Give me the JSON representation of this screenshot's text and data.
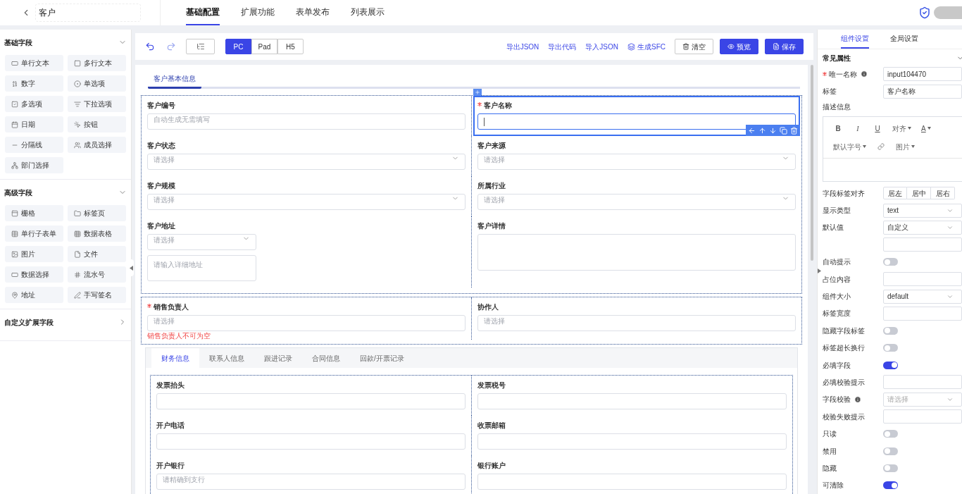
{
  "header": {
    "title": "客户",
    "tabs": [
      {
        "label": "基础配置",
        "selected": true
      },
      {
        "label": "扩展功能",
        "selected": false
      },
      {
        "label": "表单发布",
        "selected": false
      },
      {
        "label": "列表展示",
        "selected": false
      }
    ]
  },
  "palette": [
    {
      "title": "基础字段",
      "expanded": true,
      "items": [
        "单行文本",
        "多行文本",
        "数字",
        "单选项",
        "多选项",
        "下拉选项",
        "日期",
        "按钮",
        "分隔线",
        "成员选择",
        "部门选择"
      ]
    },
    {
      "title": "高级字段",
      "expanded": true,
      "items": [
        "栅格",
        "标签页",
        "单行子表单",
        "数据表格",
        "图片",
        "文件",
        "数据选择",
        "流水号",
        "地址",
        "手写签名"
      ]
    },
    {
      "title": "自定义扩展字段",
      "expanded": false
    }
  ],
  "toolbar": {
    "devices": [
      {
        "label": "PC",
        "selected": true
      },
      {
        "label": "Pad",
        "selected": false
      },
      {
        "label": "H5",
        "selected": false
      }
    ],
    "links": [
      "导出JSON",
      "导出代码",
      "导入JSON",
      "生成SFC"
    ],
    "buttons": [
      {
        "label": "清空",
        "kind": "outline"
      },
      {
        "label": "预览",
        "kind": "primary"
      },
      {
        "label": "保存",
        "kind": "primary"
      }
    ]
  },
  "form": {
    "section_title": "客户基本信息",
    "grid_1": [
      {
        "kind": "input",
        "label": "客户编号",
        "placeholder": "自动生成无需填写",
        "required": false,
        "selected": false
      },
      {
        "kind": "input",
        "label": "客户名称",
        "required": true,
        "selected": true
      },
      {
        "kind": "select",
        "label": "客户状态",
        "placeholder": "请选择",
        "required": false,
        "selected": false
      },
      {
        "kind": "select",
        "label": "客户来源",
        "placeholder": "请选择",
        "required": false,
        "selected": false
      },
      {
        "kind": "select",
        "label": "客户规模",
        "placeholder": "请选择",
        "required": false,
        "selected": false
      },
      {
        "kind": "select",
        "label": "所属行业",
        "placeholder": "请选择",
        "required": false,
        "selected": false
      },
      {
        "kind": "address",
        "label": "客户地址",
        "placeholder": "请选择",
        "detail_placeholder": "请输入详细地址",
        "required": false,
        "selected": false
      },
      {
        "kind": "textarea",
        "label": "客户详情",
        "required": false,
        "selected": false
      }
    ],
    "grid_2": [
      {
        "kind": "input",
        "label": "销售负责人",
        "placeholder": "请选择",
        "required": true,
        "selected": false,
        "error": "销售负责人不可为空"
      },
      {
        "kind": "input",
        "label": "协作人",
        "placeholder": "请选择",
        "required": false,
        "selected": false
      }
    ],
    "tabs": [
      {
        "label": "财务信息",
        "selected": true
      },
      {
        "label": "联系人信息",
        "selected": false
      },
      {
        "label": "跟进记录",
        "selected": false
      },
      {
        "label": "合同信息",
        "selected": false
      },
      {
        "label": "回款/开票记录",
        "selected": false
      }
    ],
    "tab_fields": [
      {
        "kind": "input",
        "label": "发票抬头",
        "required": false,
        "selected": false
      },
      {
        "kind": "input",
        "label": "发票税号",
        "required": false,
        "selected": false
      },
      {
        "kind": "input",
        "label": "开户电话",
        "required": false,
        "selected": false
      },
      {
        "kind": "input",
        "label": "收票邮箱",
        "required": false,
        "selected": false
      },
      {
        "kind": "input",
        "label": "开户银行",
        "placeholder": "请精确到支行",
        "required": false,
        "selected": false
      },
      {
        "kind": "input",
        "label": "银行账户",
        "required": false,
        "selected": false
      }
    ]
  },
  "settings": {
    "tabs": [
      {
        "label": "组件设置",
        "selected": true
      },
      {
        "label": "全局设置",
        "selected": false
      }
    ],
    "section": "常见属性",
    "editor_tools": [
      {
        "kind": "button",
        "label": "B"
      },
      {
        "kind": "italic",
        "label": "I"
      },
      {
        "kind": "underline",
        "label": "U"
      },
      {
        "kind": "dropdown",
        "label": "对齐"
      },
      {
        "kind": "color",
        "label": "A"
      },
      {
        "kind": "dropdown",
        "label": "默认字号"
      },
      {
        "kind": "link"
      },
      {
        "kind": "dropdown",
        "label": "图片"
      }
    ],
    "rows": [
      {
        "kind": "input",
        "label": "唯一名称",
        "value": "input104470",
        "required": true,
        "info": true
      },
      {
        "kind": "input",
        "label": "标签",
        "value": "客户名称",
        "required": false,
        "info": false
      },
      {
        "kind": "editor",
        "label": "描述信息",
        "required": false,
        "info": false
      },
      {
        "kind": "segmented",
        "label": "字段标签对齐",
        "options": [
          "居左",
          "居中",
          "居右"
        ],
        "required": false,
        "info": false
      },
      {
        "kind": "select",
        "label": "显示类型",
        "value": "text",
        "required": false,
        "info": false
      },
      {
        "kind": "select",
        "label": "默认值",
        "value": "自定义",
        "required": false,
        "info": false
      },
      {
        "kind": "input",
        "required": false,
        "info": false
      },
      {
        "kind": "toggle",
        "label": "自动提示",
        "on": false,
        "required": false,
        "info": false
      },
      {
        "kind": "input",
        "label": "占位内容",
        "required": false,
        "info": false
      },
      {
        "kind": "select",
        "label": "组件大小",
        "value": "default",
        "required": false,
        "info": false
      },
      {
        "kind": "input",
        "label": "标签宽度",
        "required": false,
        "info": false
      },
      {
        "kind": "toggle",
        "label": "隐藏字段标签",
        "on": false,
        "required": false,
        "info": false
      },
      {
        "kind": "toggle",
        "label": "标签超长换行",
        "on": false,
        "required": false,
        "info": false
      },
      {
        "kind": "toggle",
        "label": "必填字段",
        "on": true,
        "required": false,
        "info": false
      },
      {
        "kind": "input",
        "label": "必填校验提示",
        "required": false,
        "info": false
      },
      {
        "kind": "select",
        "label": "字段校验",
        "placeholder": "请选择",
        "required": false,
        "info": true
      },
      {
        "kind": "input",
        "label": "校验失败提示",
        "required": false,
        "info": false
      },
      {
        "kind": "toggle",
        "label": "只读",
        "on": false,
        "required": false,
        "info": false
      },
      {
        "kind": "toggle",
        "label": "禁用",
        "on": false,
        "required": false,
        "info": false
      },
      {
        "kind": "toggle",
        "label": "隐藏",
        "on": false,
        "required": false,
        "info": false
      },
      {
        "kind": "toggle",
        "label": "可清除",
        "on": true,
        "required": false,
        "info": false
      }
    ]
  }
}
